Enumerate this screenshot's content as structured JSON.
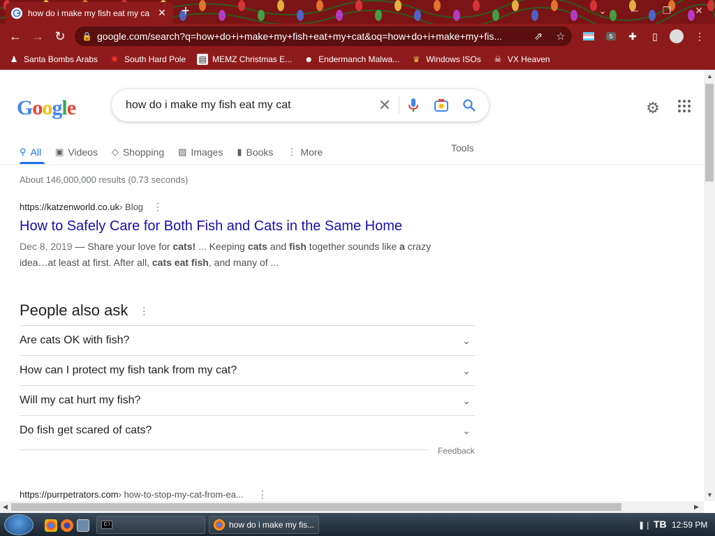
{
  "browser": {
    "tab_title": "how do i make my fish eat my ca",
    "url": "google.com/search?q=how+do+i+make+my+fish+eat+my+cat&oq=how+do+i+make+my+fis...",
    "theme_color": "#8e1b1b"
  },
  "bookmarks": [
    {
      "label": "Santa Bombs Arabs",
      "icon": "user-icon"
    },
    {
      "label": "South Hard Pole",
      "icon": "maple-leaf-icon"
    },
    {
      "label": "MEMZ Christmas E...",
      "icon": "file-icon"
    },
    {
      "label": "Endermanch Malwa...",
      "icon": "raccoon-icon"
    },
    {
      "label": "Windows ISOs",
      "icon": "trophy-icon"
    },
    {
      "label": "VX Heaven",
      "icon": "skull-icon"
    }
  ],
  "search": {
    "query": "how do i make my fish eat my cat",
    "tabs": [
      {
        "label": "All",
        "icon": "search-icon"
      },
      {
        "label": "Videos",
        "icon": "video-icon"
      },
      {
        "label": "Shopping",
        "icon": "tag-icon"
      },
      {
        "label": "Images",
        "icon": "image-icon"
      },
      {
        "label": "Books",
        "icon": "book-icon"
      },
      {
        "label": "More",
        "icon": "more-vert-icon"
      }
    ],
    "tools_label": "Tools",
    "stats": "About 146,000,000 results (0.73 seconds)"
  },
  "result1": {
    "site": "https://katzenworld.co.uk",
    "crumb": " › Blog",
    "title": "How to Safely Care for Both Fish and Cats in the Same Home",
    "date": "Dec 8, 2019",
    "snip_a": " — Share your love for ",
    "snip_b": "cats!",
    "snip_c": " ... Keeping ",
    "snip_d": "cats",
    "snip_e": " and ",
    "snip_f": "fish",
    "snip_g": " together sounds like ",
    "snip_h": "a",
    "snip_i": " crazy idea…at least at first. After all, ",
    "snip_j": "cats eat fish",
    "snip_k": ", and many of ..."
  },
  "paa": {
    "heading": "People also ask",
    "questions": [
      "Are cats OK with fish?",
      "How can I protect my fish tank from my cat?",
      "Will my cat hurt my fish?",
      "Do fish get scared of cats?"
    ],
    "feedback": "Feedback"
  },
  "result2": {
    "site": "https://purrpetrators.com",
    "crumb": " › how-to-stop-my-cat-from-ea..."
  },
  "taskbar": {
    "task_label": "how do i make my fis...",
    "clock": "12:59 PM"
  }
}
